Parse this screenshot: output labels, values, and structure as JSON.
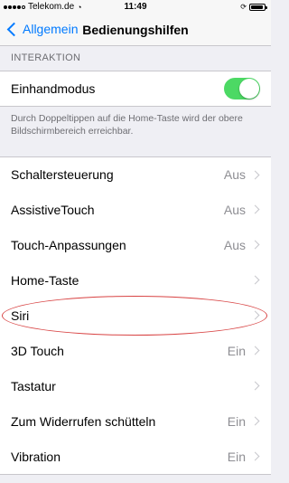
{
  "statusbar": {
    "carrier": "Telekom.de",
    "time": "11:49",
    "signal_bars": 4,
    "signal_total": 5,
    "battery_level": 0.92
  },
  "navbar": {
    "back_label": "Allgemein",
    "title": "Bedienungshilfen"
  },
  "section": {
    "header": "INTERAKTION",
    "toggle_row": {
      "label": "Einhandmodus",
      "on": true
    },
    "footer": "Durch Doppeltippen auf die Home-Taste wird der obere Bildschirmbereich erreichbar."
  },
  "rows": [
    {
      "label": "Schaltersteuerung",
      "value": "Aus"
    },
    {
      "label": "AssistiveTouch",
      "value": "Aus"
    },
    {
      "label": "Touch-Anpassungen",
      "value": "Aus"
    },
    {
      "label": "Home-Taste",
      "value": ""
    },
    {
      "label": "Siri",
      "value": ""
    },
    {
      "label": "3D Touch",
      "value": "Ein"
    },
    {
      "label": "Tastatur",
      "value": ""
    },
    {
      "label": "Zum Widerrufen schütteln",
      "value": "Ein"
    },
    {
      "label": "Vibration",
      "value": "Ein"
    }
  ],
  "colors": {
    "accent": "#007aff",
    "toggle_on": "#4cd964",
    "highlight": "#d84343"
  }
}
